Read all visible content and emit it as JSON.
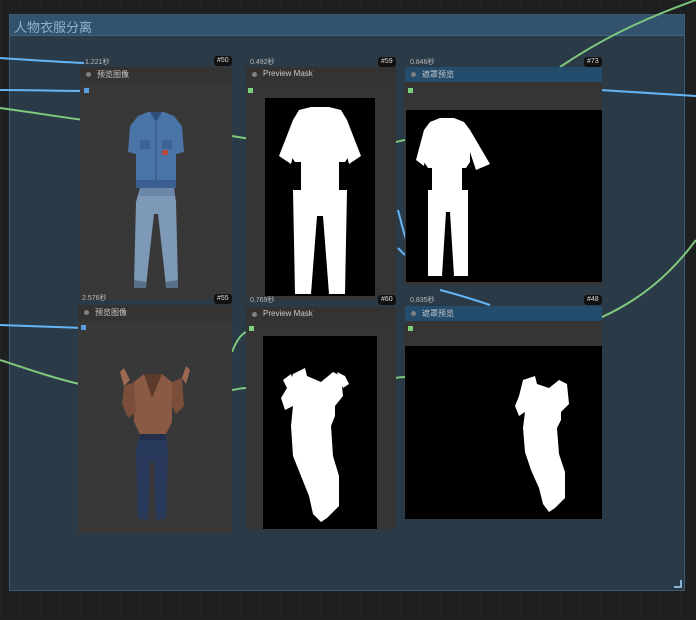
{
  "group": {
    "title": "人物衣服分离"
  },
  "nodes": [
    {
      "id": "node-50",
      "timing": "1.221秒",
      "badge": "#50",
      "title": "预览图像",
      "header": "gray"
    },
    {
      "id": "node-59",
      "timing": "0.492秒",
      "badge": "#59",
      "title": "Preview Mask",
      "header": "gray"
    },
    {
      "id": "node-73",
      "timing": "0.846秒",
      "badge": "#73",
      "title": "遮罩预览",
      "header": "blue"
    },
    {
      "id": "node-55",
      "timing": "2.576秒",
      "badge": "#55",
      "title": "预览图像",
      "header": "gray"
    },
    {
      "id": "node-60",
      "timing": "0.769秒",
      "badge": "#60",
      "title": "Preview Mask",
      "header": "gray"
    },
    {
      "id": "node-48",
      "timing": "0.835秒",
      "badge": "#48",
      "title": "遮罩预览",
      "header": "blue"
    }
  ],
  "colors": {
    "group_bg": "#2b3a47",
    "group_header": "#33536d",
    "wire_blue": "#64b5f6",
    "wire_green": "#7fc97f",
    "socket_blue": "#5aa0e0",
    "socket_green": "#7fd07f"
  }
}
